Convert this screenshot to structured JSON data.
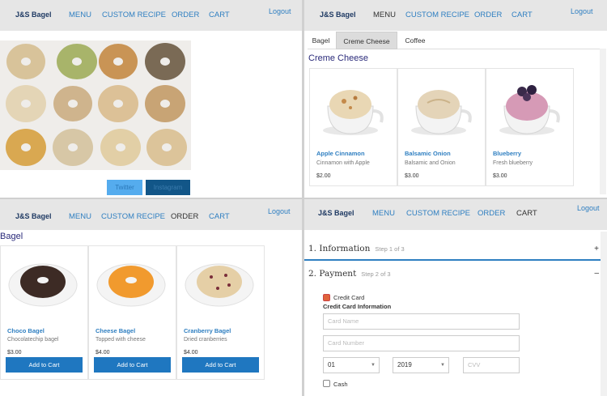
{
  "nav": {
    "brand": "J&S Bagel",
    "menu": "MENU",
    "custom_recipe": "CUSTOM RECIPE",
    "order": "ORDER",
    "cart": "CART",
    "logout": "Logout"
  },
  "home": {
    "twitter_label": "Twitter",
    "instagram_label": "Instagram"
  },
  "menu_page": {
    "tabs": [
      "Bagel",
      "Creme Cheese",
      "Coffee"
    ],
    "active_tab": "Creme Cheese",
    "section_title": "Creme Cheese",
    "products": [
      {
        "name": "Apple Cinnamon",
        "desc": "Cinnamon with Apple",
        "price": "$2.00"
      },
      {
        "name": "Balsamic Onion",
        "desc": "Balsamic and Onion",
        "price": "$3.00"
      },
      {
        "name": "Blueberry",
        "desc": "Fresh blueberry",
        "price": "$3.00"
      }
    ]
  },
  "order_page": {
    "section_title": "Bagel",
    "add_label": "Add to Cart",
    "products": [
      {
        "name": "Choco Bagel",
        "desc": "Chocolatechip bagel",
        "price": "$3.00"
      },
      {
        "name": "Cheese Bagel",
        "desc": "Topped with cheese",
        "price": "$4.00"
      },
      {
        "name": "Cranberry Bagel",
        "desc": "Dried cranberries",
        "price": "$4.00"
      }
    ]
  },
  "cart_page": {
    "step1": {
      "title": "1. Information",
      "sub": "Step 1 of 3",
      "icon": "+"
    },
    "step2": {
      "title": "2. Payment",
      "sub": "Step 2 of 3",
      "icon": "–"
    },
    "credit_card_label": "Credit Card",
    "credit_info_title": "Credit Card Information",
    "card_name_placeholder": "Card Name",
    "card_number_placeholder": "Card Number",
    "month": "01",
    "year": "2019",
    "cvv_placeholder": "CVV",
    "cash_label": "Cash"
  },
  "colors": {
    "nav_bg": "#e6e6e6",
    "link": "#2f7fc1",
    "button": "#1f77c0",
    "twitter": "#55acee",
    "instagram": "#125688"
  }
}
